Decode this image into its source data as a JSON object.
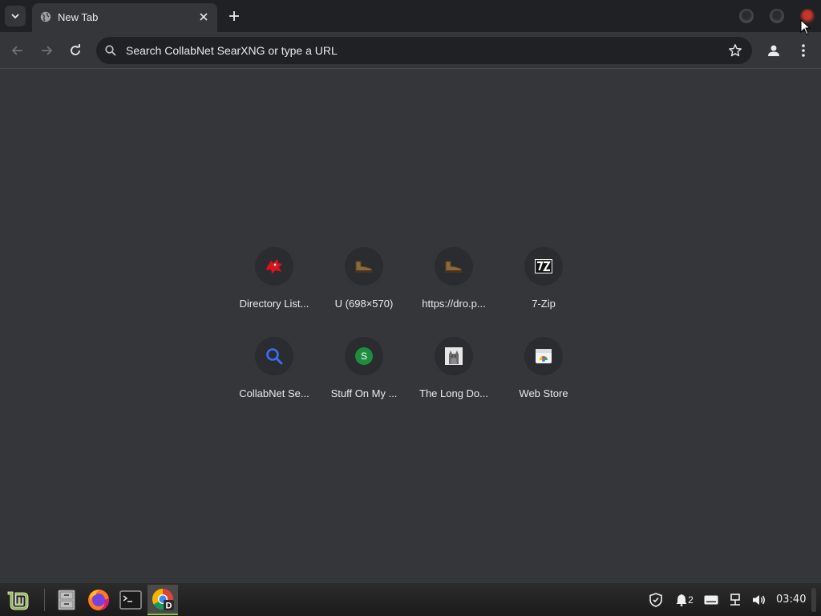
{
  "tab": {
    "title": "New Tab"
  },
  "omnibox": {
    "placeholder": "Search CollabNet SearXNG or type a URL"
  },
  "shortcuts": [
    {
      "label": "Directory List...",
      "icon": "red-creature-icon"
    },
    {
      "label": "U (698×570)",
      "icon": "boot-icon"
    },
    {
      "label": "https://dro.p...",
      "icon": "boot-icon"
    },
    {
      "label": "7-Zip",
      "icon": "7zip-icon"
    },
    {
      "label": "CollabNet Se...",
      "icon": "magnifier-icon"
    },
    {
      "label": "Stuff On My ...",
      "icon": "letter-s-icon",
      "letter": "S"
    },
    {
      "label": "The Long Do...",
      "icon": "cat-photo-icon"
    },
    {
      "label": "Web Store",
      "icon": "web-store-icon"
    }
  ],
  "taskbar": {
    "notifications_count": "2",
    "clock": "03:40"
  },
  "colors": {
    "background": "#35363a",
    "tabstrip": "#202124",
    "omnibox": "#202124",
    "mint_green": "#8fbf3f"
  }
}
